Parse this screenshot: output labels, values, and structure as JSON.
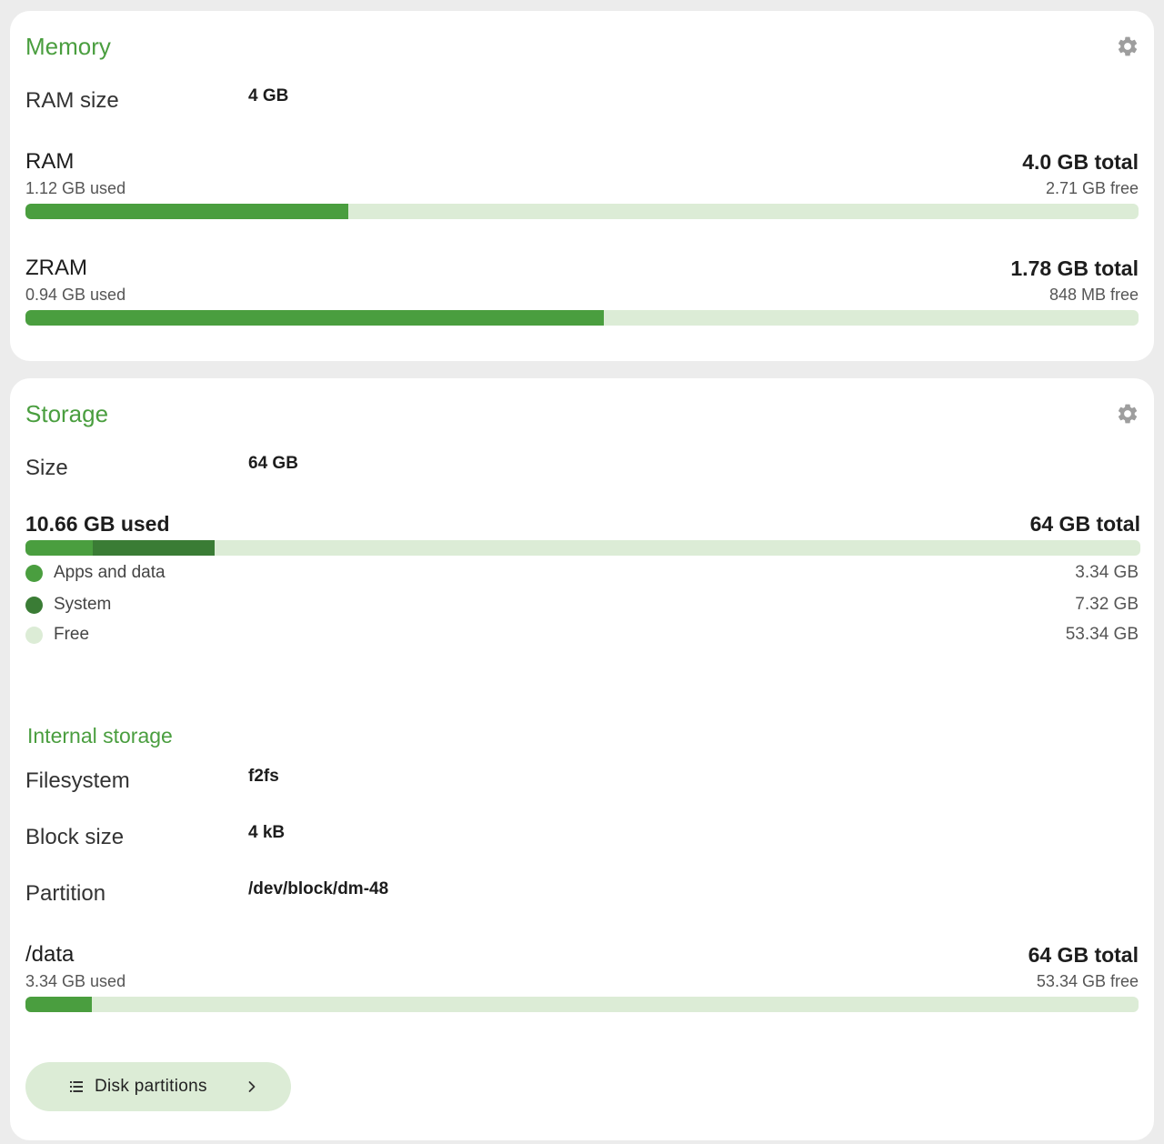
{
  "memory": {
    "title": "Memory",
    "ram_size_label": "RAM size",
    "ram_size_value": "4 GB",
    "ram": {
      "name": "RAM",
      "used": "1.12 GB used",
      "total": "4.0 GB total",
      "free": "2.71 GB free",
      "fraction": 0.29
    },
    "zram": {
      "name": "ZRAM",
      "used": "0.94 GB used",
      "total": "1.78 GB total",
      "free": "848 MB free",
      "fraction": 0.52
    }
  },
  "storage": {
    "title": "Storage",
    "size_label": "Size",
    "size_value": "64 GB",
    "used_heading": "10.66 GB used",
    "total_heading": "64 GB total",
    "segments": [
      {
        "label": "Apps and data",
        "value": "3.34 GB",
        "fraction": 0.06,
        "color": "#4a9e3f"
      },
      {
        "label": "System",
        "value": "7.32 GB",
        "fraction": 0.11,
        "color": "#3a7c35"
      },
      {
        "label": "Free",
        "value": "53.34 GB",
        "color": "#dcecd6"
      }
    ],
    "internal": {
      "title": "Internal storage",
      "filesystem_label": "Filesystem",
      "filesystem_value": "f2fs",
      "block_size_label": "Block size",
      "block_size_value": "4 kB",
      "partition_label": "Partition",
      "partition_value": "/dev/block/dm-48",
      "mount": {
        "name": "/data",
        "used": "3.34 GB used",
        "total": "64 GB total",
        "free": "53.34 GB free",
        "fraction": 0.06
      }
    },
    "disk_partitions_button": "Disk partitions"
  },
  "icons": {
    "settings": "gear-icon",
    "list": "list-icon",
    "chevron": "chevron-right-icon"
  },
  "colors": {
    "accent": "#4a9e3f",
    "accent_dark": "#3a7c35",
    "track": "#dcecd6"
  }
}
